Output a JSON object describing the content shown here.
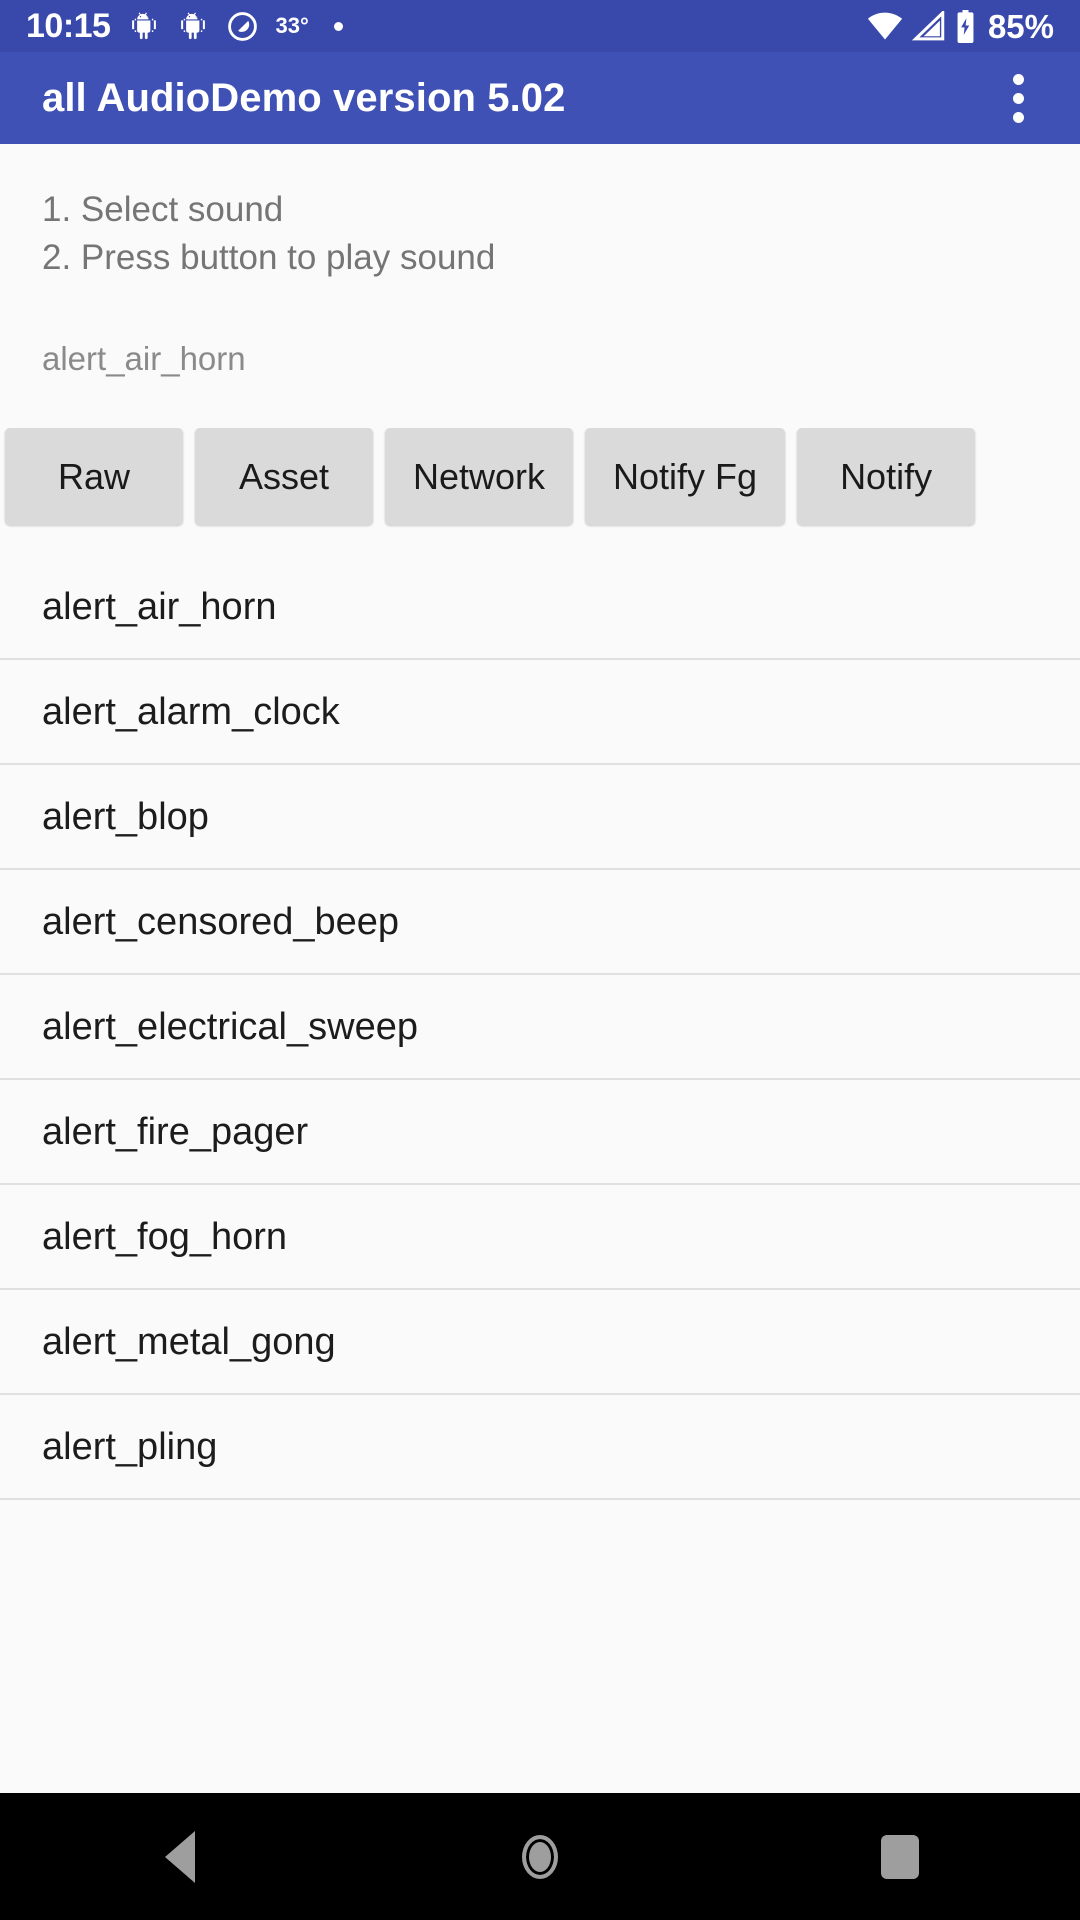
{
  "status_bar": {
    "clock": "10:15",
    "temperature": "33°",
    "battery_percent": "85%",
    "icons": [
      "android-bug-icon",
      "android-bug-icon",
      "circle-slash-icon",
      "small-dot-icon",
      "wifi-icon",
      "cell-signal-icon",
      "battery-charging-icon"
    ],
    "background_color": "#3949AB"
  },
  "app_bar": {
    "title": "all AudioDemo version 5.02",
    "overflow_label": "overflow-menu",
    "background_color": "#3F51B5",
    "text_color": "#FFFFFF"
  },
  "instructions": {
    "line1": "1. Select sound",
    "line2": "2. Press button to play sound"
  },
  "selected_sound": {
    "label": "alert_air_horn"
  },
  "buttons": [
    {
      "label": "Raw"
    },
    {
      "label": "Asset"
    },
    {
      "label": "Network"
    },
    {
      "label": "Notify Fg"
    },
    {
      "label": "Notify"
    }
  ],
  "sound_list": [
    {
      "label": "alert_air_horn"
    },
    {
      "label": "alert_alarm_clock"
    },
    {
      "label": "alert_blop"
    },
    {
      "label": "alert_censored_beep"
    },
    {
      "label": "alert_electrical_sweep"
    },
    {
      "label": "alert_fire_pager"
    },
    {
      "label": "alert_fog_horn"
    },
    {
      "label": "alert_metal_gong"
    },
    {
      "label": "alert_pling"
    }
  ],
  "nav_bar": {
    "back": "back-button",
    "home": "home-button",
    "recents": "recents-button",
    "background_color": "#000000",
    "icon_color": "#9E9E9E"
  }
}
